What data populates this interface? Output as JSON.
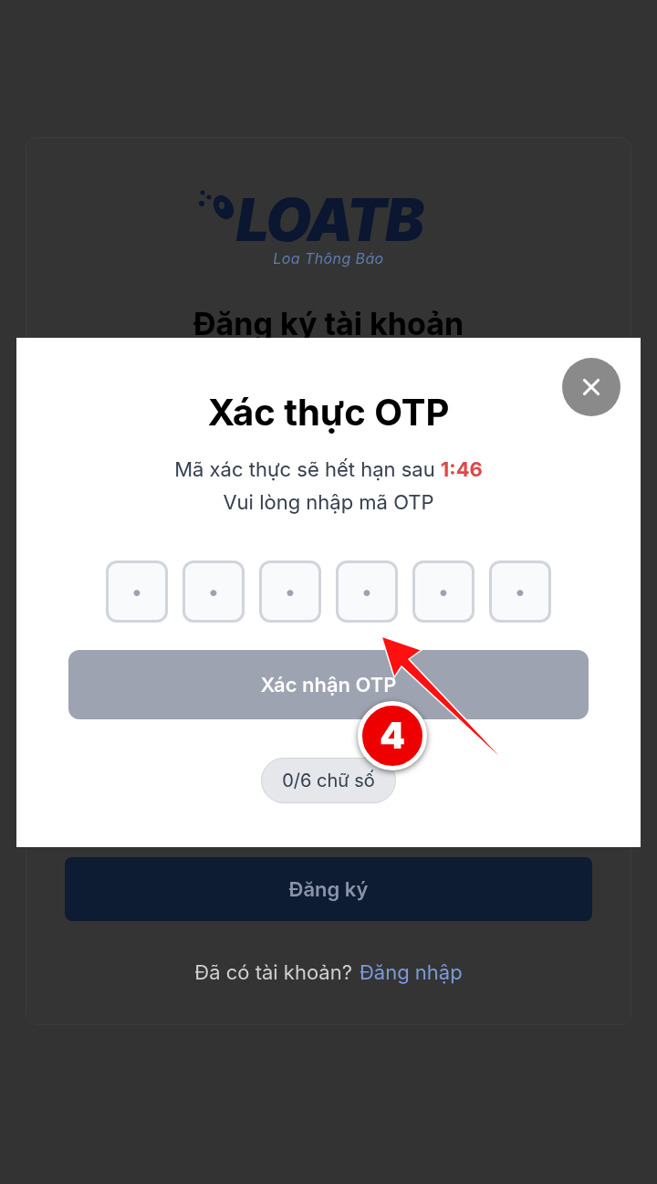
{
  "page": {
    "logo": {
      "mark": "LOATB",
      "tagline": "Loa Thông Báo"
    },
    "heading": "Đăng ký tài khoản",
    "submit_button": {
      "label": "Đăng ký"
    },
    "footer": {
      "text": "Đã có tài khoản?",
      "link": "Đăng nhập"
    }
  },
  "otp_dialog": {
    "title": "Xác thực OTP",
    "expiry_text": "Mã xác thực sẽ hết hạn sau",
    "countdown": "1:46",
    "instruction": "Vui lòng nhập mã OTP",
    "digits": [
      {
        "placeholder": "•"
      },
      {
        "placeholder": "•"
      },
      {
        "placeholder": "•"
      },
      {
        "placeholder": "•"
      },
      {
        "placeholder": "•"
      },
      {
        "placeholder": "•"
      }
    ],
    "confirm_button": {
      "label": "Xác nhận OTP",
      "disabled": true
    },
    "counter": "0/6 chữ số"
  },
  "annotation": {
    "step": "4"
  }
}
